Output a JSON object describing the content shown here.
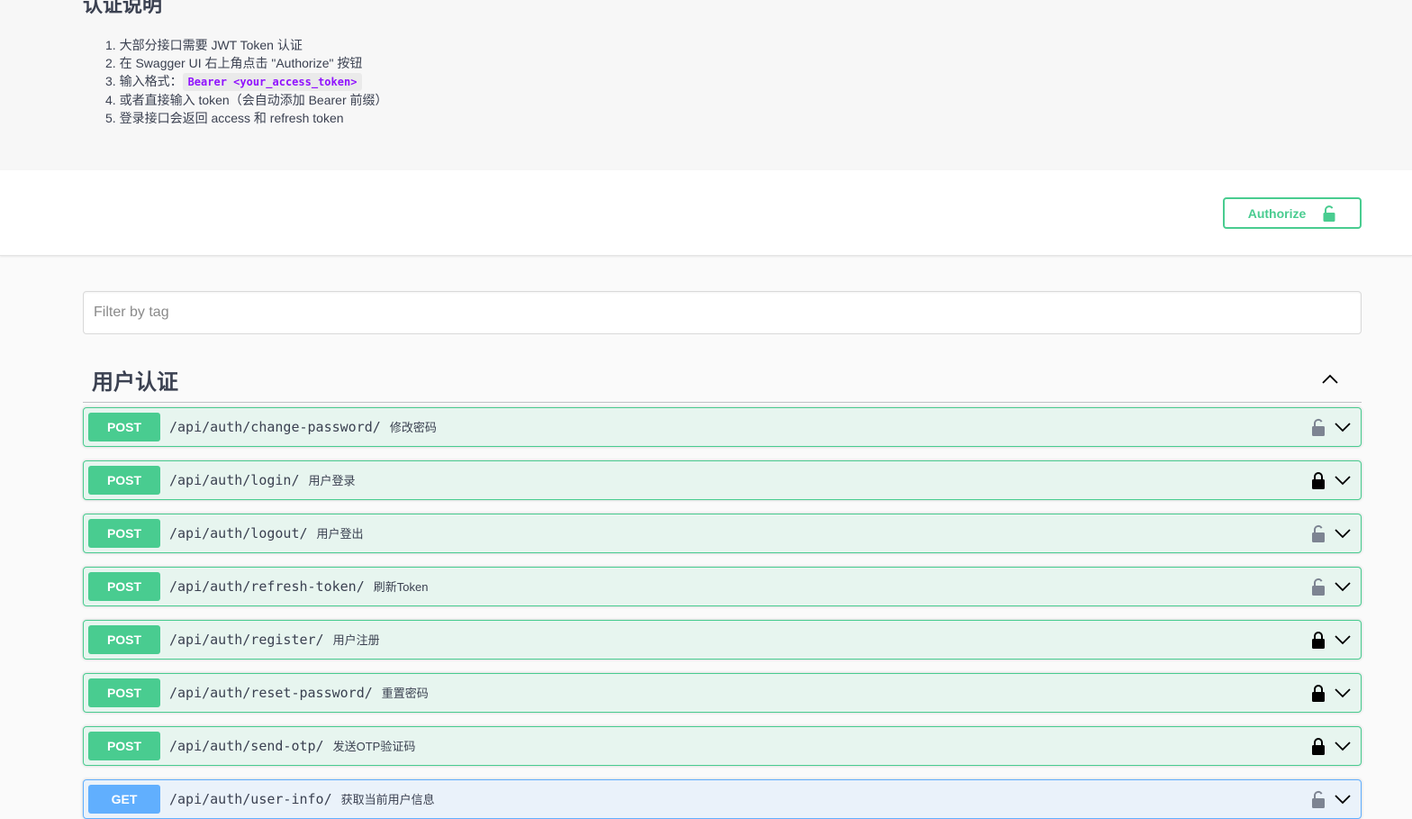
{
  "info": {
    "title": "认证说明",
    "items": [
      "1. 大部分接口需要 JWT Token 认证",
      "2. 在 Swagger UI 右上角点击 \"Authorize\" 按钮",
      "3. 输入格式：",
      "4. 或者直接输入 token（会自动添加 Bearer 前缀）",
      "5. 登录接口会返回 access 和 refresh token"
    ],
    "format_code": "Bearer <your_access_token>"
  },
  "scheme": {
    "authorize_label": "Authorize",
    "accent_color": "#49cc90"
  },
  "filter": {
    "placeholder": "Filter by tag"
  },
  "tag": {
    "name": "用户认证"
  },
  "colors": {
    "post": "#49cc90",
    "get": "#61affe"
  },
  "operations": [
    {
      "method": "POST",
      "path": "/api/auth/change-password/",
      "summary": "修改密码",
      "lock": "unlocked"
    },
    {
      "method": "POST",
      "path": "/api/auth/login/",
      "summary": "用户登录",
      "lock": "locked"
    },
    {
      "method": "POST",
      "path": "/api/auth/logout/",
      "summary": "用户登出",
      "lock": "unlocked"
    },
    {
      "method": "POST",
      "path": "/api/auth/refresh-token/",
      "summary": "刷新Token",
      "lock": "unlocked"
    },
    {
      "method": "POST",
      "path": "/api/auth/register/",
      "summary": "用户注册",
      "lock": "locked"
    },
    {
      "method": "POST",
      "path": "/api/auth/reset-password/",
      "summary": "重置密码",
      "lock": "locked"
    },
    {
      "method": "POST",
      "path": "/api/auth/send-otp/",
      "summary": "发送OTP验证码",
      "lock": "locked"
    },
    {
      "method": "GET",
      "path": "/api/auth/user-info/",
      "summary": "获取当前用户信息",
      "lock": "unlocked"
    }
  ]
}
